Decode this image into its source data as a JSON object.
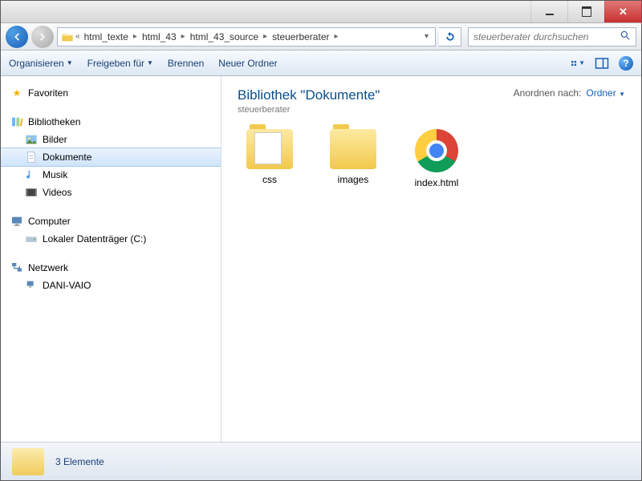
{
  "window": {
    "titlebar": {
      "min": "minimize",
      "max": "maximize",
      "close": "close"
    }
  },
  "nav": {
    "breadcrumb_prefix": "«",
    "breadcrumb": [
      "html_texte",
      "html_43",
      "html_43_source",
      "steuerberater"
    ],
    "search_placeholder": "steuerberater durchsuchen"
  },
  "toolbar": {
    "organize": "Organisieren",
    "share": "Freigeben für",
    "burn": "Brennen",
    "new_folder": "Neuer Ordner"
  },
  "sidebar": {
    "favorites": "Favoriten",
    "libraries": "Bibliotheken",
    "lib_items": [
      "Bilder",
      "Dokumente",
      "Musik",
      "Videos"
    ],
    "lib_selected_index": 1,
    "computer": "Computer",
    "computer_items": [
      "Lokaler Datenträger (C:)"
    ],
    "network": "Netzwerk",
    "network_items": [
      "DANI-VAIO"
    ]
  },
  "content": {
    "library_title": "Bibliothek \"Dokumente\"",
    "library_sub": "steuerberater",
    "arrange_label": "Anordnen nach:",
    "arrange_value": "Ordner",
    "items": [
      {
        "name": "css",
        "type": "folder-with-doc"
      },
      {
        "name": "images",
        "type": "folder"
      },
      {
        "name": "index.html",
        "type": "chrome"
      }
    ]
  },
  "status": {
    "count_text": "3 Elemente"
  }
}
